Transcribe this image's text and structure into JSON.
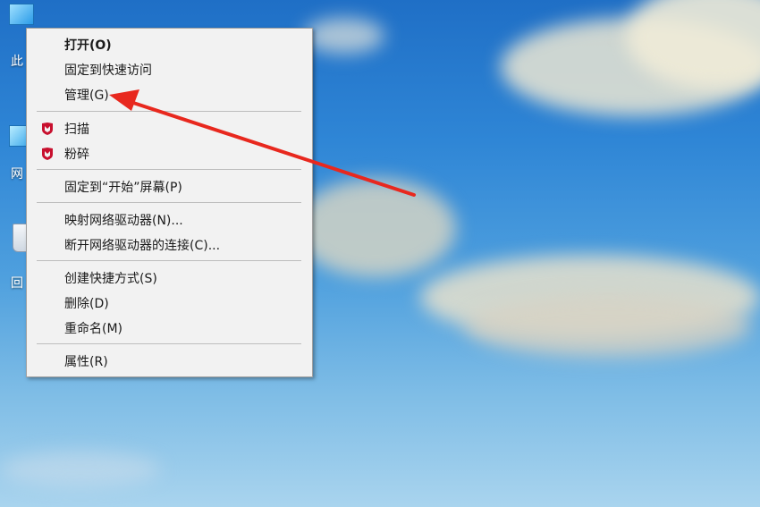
{
  "desktop": {
    "icons": [
      {
        "label": "此",
        "icon": "this-pc-icon"
      },
      {
        "label": "网",
        "icon": "network-icon"
      },
      {
        "label": "回",
        "icon": "recycle-bin-icon"
      }
    ]
  },
  "menu": {
    "items": [
      {
        "label": "打开(O)",
        "bold": true
      },
      {
        "label": "固定到快速访问"
      },
      {
        "label": "管理(G)"
      },
      {
        "label": "扫描",
        "icon": "mcafee-shield-icon"
      },
      {
        "label": "粉碎",
        "icon": "mcafee-shield-icon"
      },
      {
        "label": "固定到“开始”屏幕(P)"
      },
      {
        "label": "映射网络驱动器(N)..."
      },
      {
        "label": "断开网络驱动器的连接(C)..."
      },
      {
        "label": "创建快捷方式(S)"
      },
      {
        "label": "删除(D)"
      },
      {
        "label": "重命名(M)"
      },
      {
        "label": "属性(R)"
      }
    ]
  },
  "colors": {
    "annotation_arrow": "#e8281e",
    "mcafee_red": "#c8102e",
    "menu_bg": "#f2f2f2"
  }
}
